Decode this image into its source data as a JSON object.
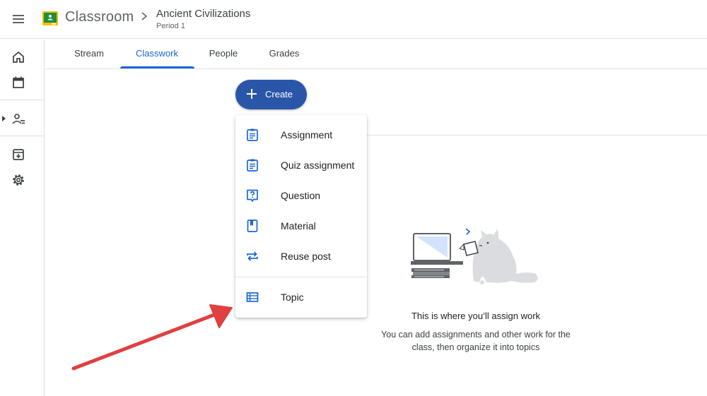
{
  "header": {
    "app_name": "Classroom",
    "class_name": "Ancient Civilizations",
    "class_section": "Period 1"
  },
  "rail": {
    "items": [
      "home-icon",
      "calendar-icon",
      "enrolled-classes-icon",
      "archive-icon",
      "settings-icon"
    ]
  },
  "tabs": [
    {
      "label": "Stream"
    },
    {
      "label": "Classwork"
    },
    {
      "label": "People"
    },
    {
      "label": "Grades"
    }
  ],
  "active_tab": "Classwork",
  "create_button": {
    "label": "Create"
  },
  "menu": {
    "items": [
      {
        "label": "Assignment",
        "icon": "assignment-icon"
      },
      {
        "label": "Quiz assignment",
        "icon": "quiz-assignment-icon"
      },
      {
        "label": "Question",
        "icon": "question-icon"
      },
      {
        "label": "Material",
        "icon": "material-icon"
      },
      {
        "label": "Reuse post",
        "icon": "reuse-icon"
      },
      {
        "label": "Topic",
        "icon": "topic-icon"
      }
    ]
  },
  "empty_state": {
    "title": "This is where you’ll assign work",
    "description": "You can add assignments and other work for the class, then organize it into topics"
  },
  "colors": {
    "accent": "#1967d2",
    "create_button": "#2956a8",
    "annotation_arrow": "#e0403f",
    "logo_green": "#1e8e3e",
    "logo_yellow": "#fbbc04"
  }
}
